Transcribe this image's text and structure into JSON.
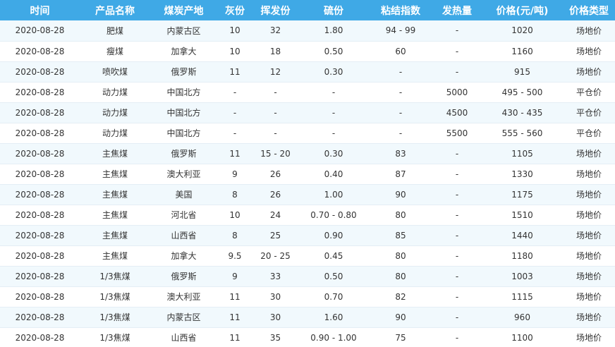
{
  "table": {
    "headers": [
      "时间",
      "产品名称",
      "煤炭产地",
      "灰份",
      "挥发份",
      "硫份",
      "粘结指数",
      "发热量",
      "价格(元/吨)",
      "价格类型"
    ],
    "rows": [
      [
        "2020-08-28",
        "肥煤",
        "内蒙古区",
        "10",
        "32",
        "1.80",
        "94 - 99",
        "-",
        "1020",
        "场地价"
      ],
      [
        "2020-08-28",
        "瘦煤",
        "加拿大",
        "10",
        "18",
        "0.50",
        "60",
        "-",
        "1160",
        "场地价"
      ],
      [
        "2020-08-28",
        "喷吹煤",
        "俄罗斯",
        "11",
        "12",
        "0.30",
        "-",
        "-",
        "915",
        "场地价"
      ],
      [
        "2020-08-28",
        "动力煤",
        "中国北方",
        "-",
        "-",
        "-",
        "-",
        "5000",
        "495 - 500",
        "平仓价"
      ],
      [
        "2020-08-28",
        "动力煤",
        "中国北方",
        "-",
        "-",
        "-",
        "-",
        "4500",
        "430 - 435",
        "平仓价"
      ],
      [
        "2020-08-28",
        "动力煤",
        "中国北方",
        "-",
        "-",
        "-",
        "-",
        "5500",
        "555 - 560",
        "平仓价"
      ],
      [
        "2020-08-28",
        "主焦煤",
        "俄罗斯",
        "11",
        "15 - 20",
        "0.30",
        "83",
        "-",
        "1105",
        "场地价"
      ],
      [
        "2020-08-28",
        "主焦煤",
        "澳大利亚",
        "9",
        "26",
        "0.40",
        "87",
        "-",
        "1330",
        "场地价"
      ],
      [
        "2020-08-28",
        "主焦煤",
        "美国",
        "8",
        "26",
        "1.00",
        "90",
        "-",
        "1175",
        "场地价"
      ],
      [
        "2020-08-28",
        "主焦煤",
        "河北省",
        "10",
        "24",
        "0.70 - 0.80",
        "80",
        "-",
        "1510",
        "场地价"
      ],
      [
        "2020-08-28",
        "主焦煤",
        "山西省",
        "8",
        "25",
        "0.90",
        "85",
        "-",
        "1440",
        "场地价"
      ],
      [
        "2020-08-28",
        "主焦煤",
        "加拿大",
        "9.5",
        "20 - 25",
        "0.45",
        "80",
        "-",
        "1180",
        "场地价"
      ],
      [
        "2020-08-28",
        "1/3焦煤",
        "俄罗斯",
        "9",
        "33",
        "0.50",
        "80",
        "-",
        "1003",
        "场地价"
      ],
      [
        "2020-08-28",
        "1/3焦煤",
        "澳大利亚",
        "11",
        "30",
        "0.70",
        "82",
        "-",
        "1115",
        "场地价"
      ],
      [
        "2020-08-28",
        "1/3焦煤",
        "内蒙古区",
        "11",
        "30",
        "1.60",
        "90",
        "-",
        "960",
        "场地价"
      ],
      [
        "2020-08-28",
        "1/3焦煤",
        "山西省",
        "11",
        "35",
        "0.90 - 1.00",
        "75",
        "-",
        "1100",
        "场地价"
      ]
    ]
  },
  "colors": {
    "header_bg": "#3fa9e6",
    "header_text": "#ffffff",
    "row_alt_bg": "#f1f9fd",
    "row_bg": "#ffffff",
    "cell_text": "#333333"
  }
}
